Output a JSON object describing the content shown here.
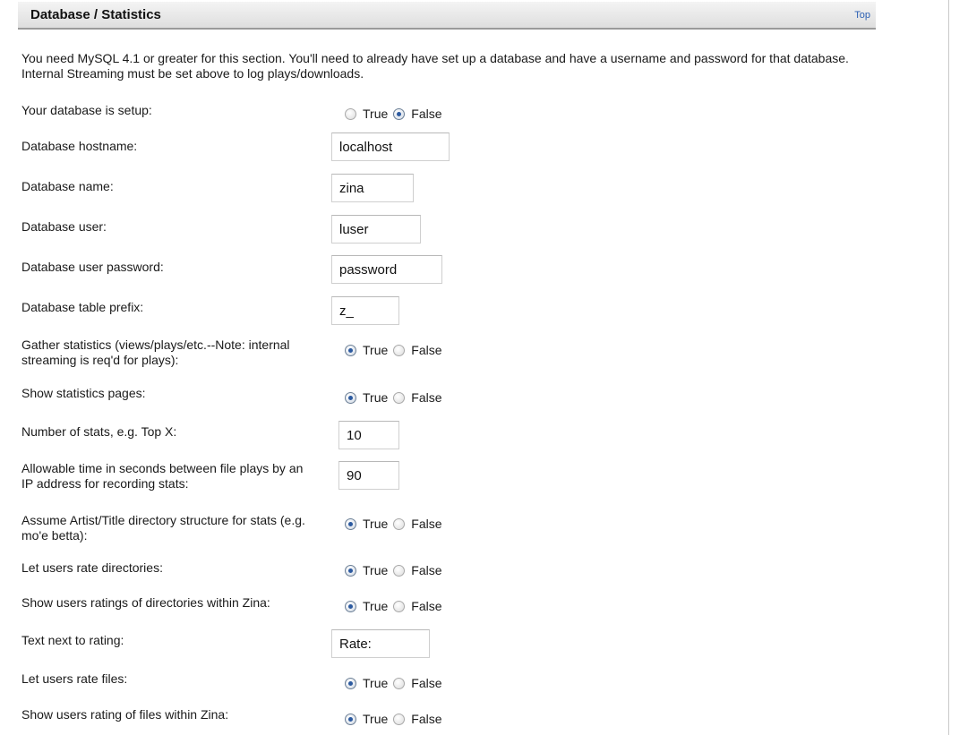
{
  "section": {
    "title": "Database / Statistics",
    "top_link": "Top"
  },
  "intro": "You need MySQL 4.1 or greater for this section. You'll need to already have set up a database and have a username and password for that database. Internal Streaming must be set above to log plays/downloads.",
  "radio_labels": {
    "true": "True",
    "false": "False"
  },
  "fields": {
    "db_setup": {
      "label": "Your database is setup:",
      "selected": "False"
    },
    "db_hostname": {
      "label": "Database hostname:",
      "value": "localhost"
    },
    "db_name": {
      "label": "Database name:",
      "value": "zina"
    },
    "db_user": {
      "label": "Database user:",
      "value": "luser"
    },
    "db_password": {
      "label": "Database user password:",
      "value": "password"
    },
    "db_prefix": {
      "label": "Database table prefix:",
      "value": "z_"
    },
    "gather_stats": {
      "label": "Gather statistics (views/plays/etc.--Note: internal streaming is req'd for plays):",
      "selected": "True"
    },
    "show_stats": {
      "label": "Show statistics pages:",
      "selected": "True"
    },
    "num_stats": {
      "label": "Number of stats, e.g. Top X:",
      "value": "10"
    },
    "allow_time": {
      "label": "Allowable time in seconds between file plays by an IP address for recording stats:",
      "value": "90"
    },
    "assume_structure": {
      "label": "Assume Artist/Title directory structure for stats (e.g. mo'e betta):",
      "selected": "True"
    },
    "rate_dirs": {
      "label": "Let users rate directories:",
      "selected": "True"
    },
    "show_dir_ratings": {
      "label": "Show users ratings of directories within Zina:",
      "selected": "True"
    },
    "rating_text": {
      "label": "Text next to rating:",
      "value": "Rate:"
    },
    "rate_files": {
      "label": "Let users rate files:",
      "selected": "True"
    },
    "show_file_ratings": {
      "label": "Show users rating of files within Zina:",
      "selected": "True"
    }
  },
  "colors": {
    "header_bg": "#e6e6e6",
    "header_border": "#9a9a9a",
    "link": "#2b5fb3",
    "radio_dot": "#2c5aa0"
  }
}
